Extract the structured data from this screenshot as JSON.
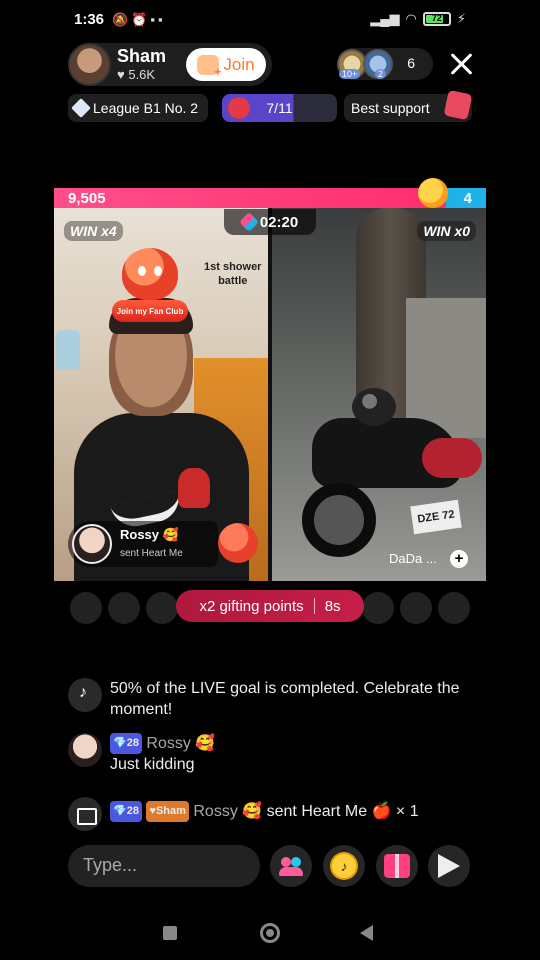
{
  "status_bar": {
    "time": "1:36",
    "battery": "72"
  },
  "host": {
    "name": "Sham",
    "likes": "5.6K",
    "join_label": "Join"
  },
  "viewers": {
    "badge1": "10+",
    "badge2": "2",
    "count": "6"
  },
  "chips": {
    "league": "League B1 No. 2",
    "goal_progress": "7/11",
    "best_support": "Best support"
  },
  "battle": {
    "score_left": "9,505",
    "score_right": "4",
    "win_left": "WIN x4",
    "win_right": "WIN x0",
    "timer": "02:20",
    "fan_club_label": "Join my Fan Club",
    "shower_line1": "1st shower",
    "shower_line2": "battle",
    "gifter_name": "Rossy",
    "gifter_sub": "sent Heart Me",
    "opponent_name": "DaDa ...",
    "plate": "DZE 72"
  },
  "gifting_points": {
    "label": "x2 gifting points",
    "seconds": "8s"
  },
  "chat": {
    "tiktok_note": "50% of the LIVE goal is completed. Celebrate the moment!",
    "rossy_level": "28",
    "rossy_name": "Rossy",
    "rossy_message": "Just kidding",
    "gift_level": "28",
    "gift_team_badge": "Sham",
    "gift_sender": "Rossy",
    "gift_text": "sent Heart Me",
    "gift_count": "× 1"
  },
  "input": {
    "placeholder": "Type..."
  },
  "colors": {
    "accent_pink": "#ff2c6e",
    "accent_blue": "#1fb2e8",
    "join_orange": "#fe7a2f",
    "goal_purple": "#5a45c9"
  }
}
